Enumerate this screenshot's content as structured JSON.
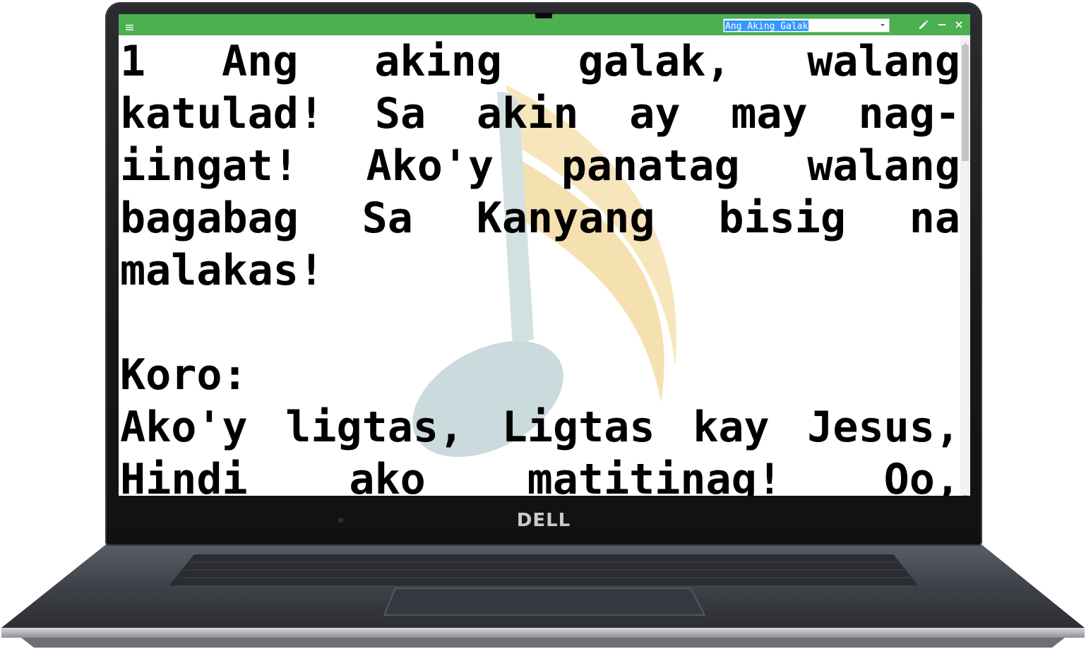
{
  "device": {
    "brand": "DELL"
  },
  "titlebar": {
    "color": "#4caf50",
    "menu_icon": "hamburger-menu-icon",
    "song_selector": {
      "selected": "Ang Aking Galak"
    },
    "buttons": [
      {
        "icon": "pencil-icon"
      },
      {
        "icon": "minimize-icon"
      },
      {
        "icon": "close-icon"
      }
    ]
  },
  "lyrics": {
    "verse_1": "1 Ang aking galak, walang katulad! Sa akin ay may nag-iingat! Ako'y panatag walang bagabag Sa Kanyang bisig na malakas!",
    "chorus_label": "Koro:",
    "chorus": "Ako'y ligtas, Ligtas kay Jesus, Hindi ako matitinag! Oo, panatag, Oo panatag, At panatag Sa Kanyang"
  },
  "watermark": {
    "icon": "music-note-icon",
    "colors": {
      "note": "#cddcde",
      "flag": "#f6e2b3"
    }
  }
}
